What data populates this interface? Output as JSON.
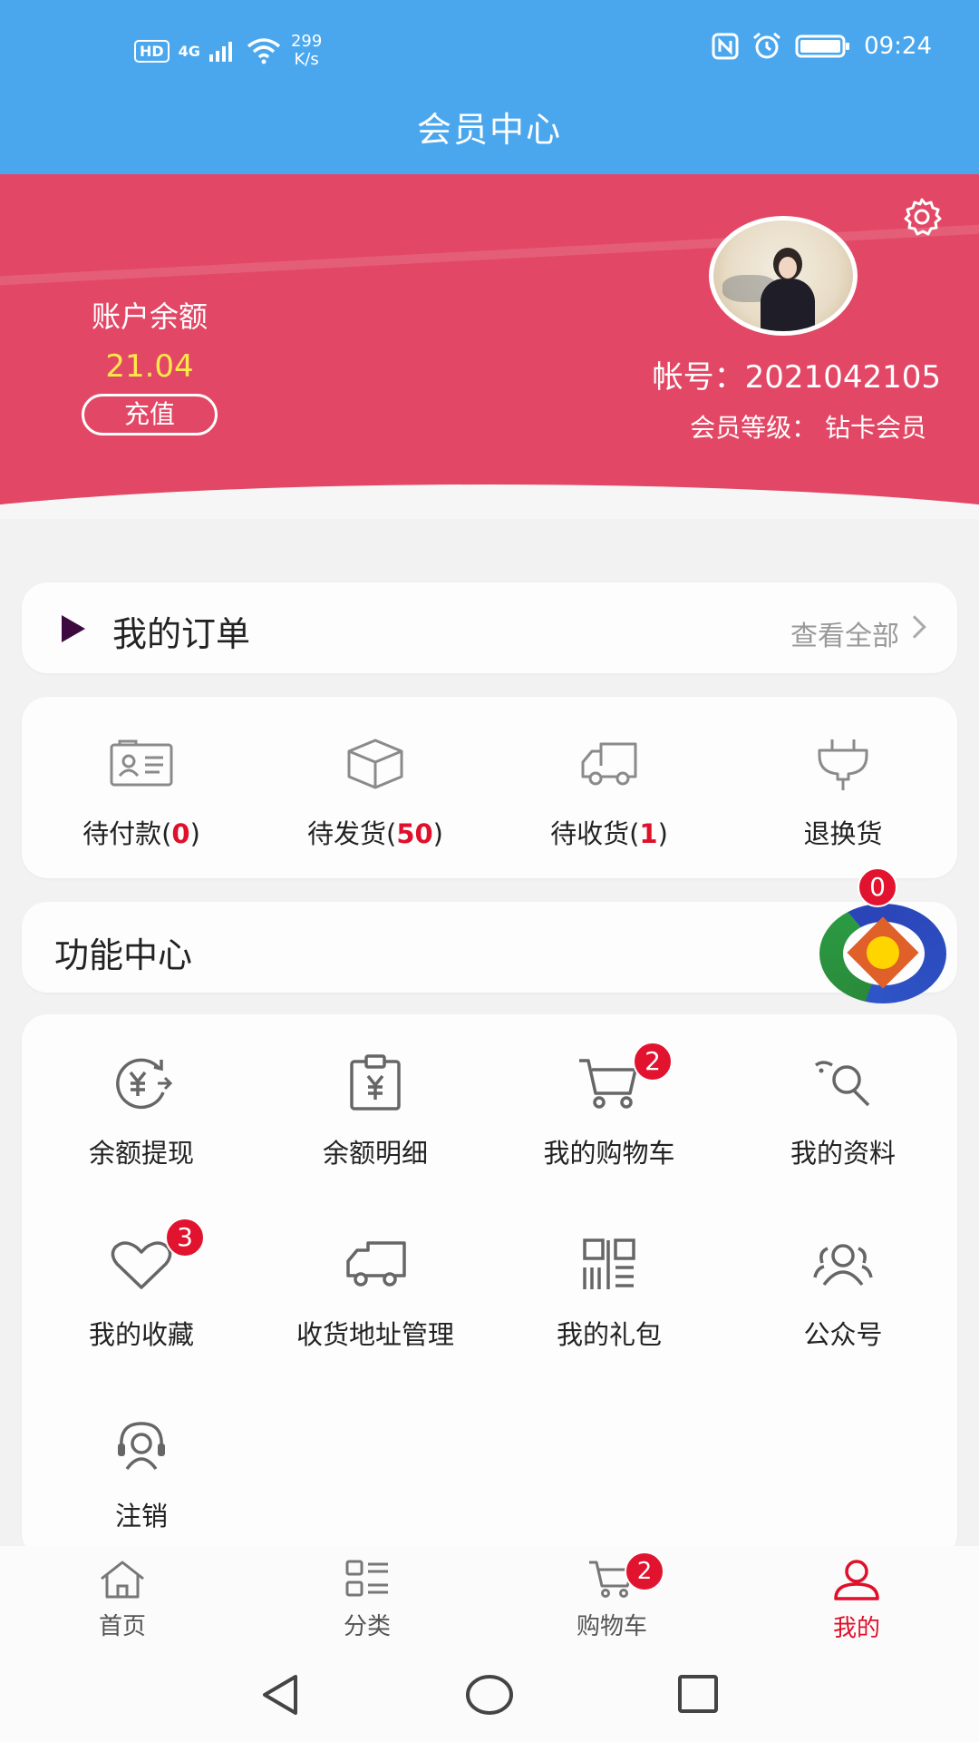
{
  "status_bar": {
    "hd": "HD",
    "network": "4G",
    "speed_value": "299",
    "speed_unit": "K/s",
    "time": "09:24"
  },
  "header": {
    "title": "会员中心"
  },
  "account": {
    "balance_label": "账户余额",
    "balance_value": "21.04",
    "recharge_label": "充值",
    "account_number": "帐号：2021042105",
    "member_level": "会员等级： 钻卡会员"
  },
  "orders": {
    "title": "我的订单",
    "view_all": "查看全部",
    "items": [
      {
        "label": "待付款(",
        "count": "0",
        "suffix": ")",
        "icon": "id-card-icon"
      },
      {
        "label": "待发货(",
        "count": "50",
        "suffix": ")",
        "icon": "box-icon"
      },
      {
        "label": "待收货(",
        "count": "1",
        "suffix": ")",
        "icon": "truck-icon"
      },
      {
        "label": "退换货",
        "count": "",
        "suffix": "",
        "icon": "plug-icon"
      }
    ]
  },
  "functions": {
    "title": "功能中心",
    "floating_badge": "0",
    "items": [
      {
        "label": "余额提现",
        "icon": "withdraw-yuan-icon",
        "badge": ""
      },
      {
        "label": "余额明细",
        "icon": "clipboard-yuan-icon",
        "badge": ""
      },
      {
        "label": "我的购物车",
        "icon": "cart-icon",
        "badge": "2"
      },
      {
        "label": "我的资料",
        "icon": "profile-icon",
        "badge": ""
      },
      {
        "label": "我的收藏",
        "icon": "heart-icon",
        "badge": "3"
      },
      {
        "label": "收货地址管理",
        "icon": "truck-address-icon",
        "badge": ""
      },
      {
        "label": "我的礼包",
        "icon": "qr-code-icon",
        "badge": ""
      },
      {
        "label": "公众号",
        "icon": "users-icon",
        "badge": ""
      },
      {
        "label": "注销",
        "icon": "logout-user-icon",
        "badge": ""
      }
    ]
  },
  "tabbar": {
    "items": [
      {
        "label": "首页",
        "icon": "home-icon"
      },
      {
        "label": "分类",
        "icon": "category-icon"
      },
      {
        "label": "购物车",
        "icon": "cart-icon",
        "badge": "2"
      },
      {
        "label": "我的",
        "icon": "user-icon",
        "active": true
      }
    ]
  },
  "colors": {
    "header_blue": "#4aa7ee",
    "banner_red": "#e24866",
    "balance_yellow": "#ffe84a",
    "badge_red": "#e2132f",
    "active_red": "#e0102b"
  }
}
